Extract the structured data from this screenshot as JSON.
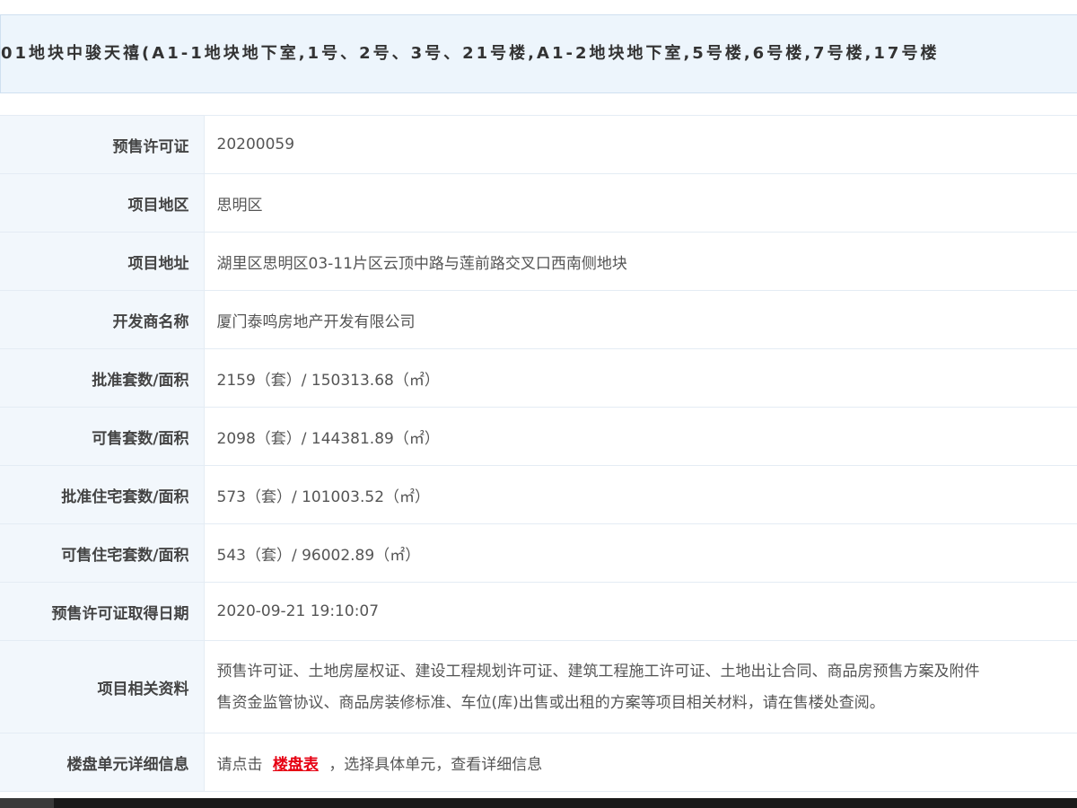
{
  "header": {
    "title": "01地块中骏天禧(A1-1地块地下室,1号、2号、3号、21号楼,A1-2地块地下室,5号楼,6号楼,7号楼,17号楼"
  },
  "rows": [
    {
      "label": "预售许可证",
      "value": "20200059"
    },
    {
      "label": "项目地区",
      "value": "思明区"
    },
    {
      "label": "项目地址",
      "value": "湖里区思明区03-11片区云顶中路与莲前路交叉口西南侧地块"
    },
    {
      "label": "开发商名称",
      "value": "厦门泰鸣房地产开发有限公司"
    },
    {
      "label": "批准套数/面积",
      "value": "2159（套）/ 150313.68（㎡）"
    },
    {
      "label": "可售套数/面积",
      "value": "2098（套）/ 144381.89（㎡）"
    },
    {
      "label": "批准住宅套数/面积",
      "value": "573（套）/ 101003.52（㎡）"
    },
    {
      "label": "可售住宅套数/面积",
      "value": "543（套）/ 96002.89（㎡）"
    },
    {
      "label": "预售许可证取得日期",
      "value": "2020-09-21 19:10:07"
    }
  ],
  "materials": {
    "label": "项目相关资料",
    "line1": "预售许可证、土地房屋权证、建设工程规划许可证、建筑工程施工许可证、土地出让合同、商品房预售方案及附件",
    "line2": "售资金监管协议、商品房装修标准、车位(库)出售或出租的方案等项目相关材料，请在售楼处查阅。"
  },
  "unit_info": {
    "label": "楼盘单元详细信息",
    "prefix": "请点击",
    "link_text": "楼盘表",
    "suffix": "，选择具体单元，查看详细信息",
    "link_color": "#e60012"
  }
}
